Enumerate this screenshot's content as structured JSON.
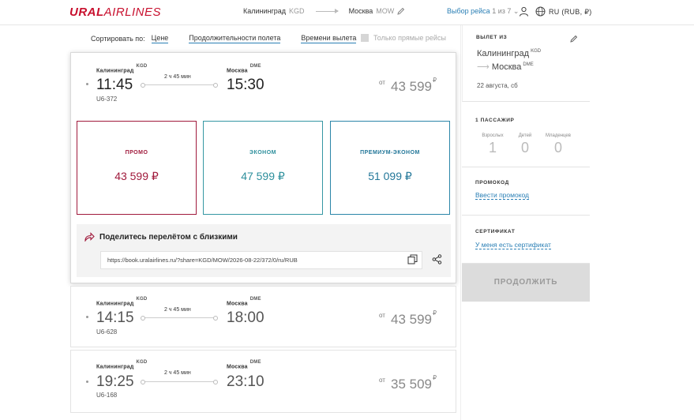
{
  "header": {
    "logo_bold": "URAL",
    "logo_rest": "AIRLINES",
    "from_city": "Калининград",
    "from_code": "KGD",
    "to_city": "Москва",
    "to_code": "MOW",
    "flight_select_label": "Выбор рейса",
    "flight_select_count": "1 из 7",
    "language": "RU (RUB, ₽)"
  },
  "sortbar": {
    "label": "Сортировать по:",
    "options": [
      "Цене",
      "Продолжительности полета",
      "Времени вылета"
    ],
    "direct_only": "Только прямые рейсы"
  },
  "flights": [
    {
      "from_city": "Калининград",
      "from_code": "KGD",
      "to_city": "Москва",
      "to_code": "DME",
      "dep": "11:45",
      "arr": "15:30",
      "duration": "2 ч 45 мин",
      "flight_no": "U6-372",
      "from_label": "от",
      "price": "43 599",
      "currency": "₽"
    },
    {
      "from_city": "Калининград",
      "from_code": "KGD",
      "to_city": "Москва",
      "to_code": "DME",
      "dep": "14:15",
      "arr": "18:00",
      "duration": "2 ч 45 мин",
      "flight_no": "U6-628",
      "from_label": "от",
      "price": "43 599",
      "currency": "₽"
    },
    {
      "from_city": "Калининград",
      "from_code": "KGD",
      "to_city": "Москва",
      "to_code": "DME",
      "dep": "19:25",
      "arr": "23:10",
      "duration": "2 ч 45 мин",
      "flight_no": "U6-168",
      "from_label": "от",
      "price": "35 509",
      "currency": "₽"
    }
  ],
  "fares": [
    {
      "name": "ПРОМО",
      "price": "43 599 ₽",
      "color": "#a01a3c"
    },
    {
      "name": "ЭКОНОМ",
      "price": "47 599 ₽",
      "color": "#2d8f9c"
    },
    {
      "name": "ПРЕМИУМ-ЭКОНОМ",
      "price": "51 099 ₽",
      "color": "#237799"
    }
  ],
  "share": {
    "title": "Поделитесь перелётом с близкими",
    "url": "https://book.uralairlines.ru/?share=KGD/MOW/2026-08-22/372/0/ru/RUB"
  },
  "sidebar": {
    "departure_label": "ВЫЛЕТ ИЗ",
    "from_city": "Калининград",
    "from_code": "KGD",
    "to_city": "Москва",
    "to_code": "DME",
    "date": "22 августа, сб",
    "passengers_label": "1 ПАССАЖИР",
    "adults_label": "Взрослых",
    "adults": "1",
    "children_label": "Детей",
    "children": "0",
    "infants_label": "Младенцев",
    "infants": "0",
    "promo_label": "ПРОМОКОД",
    "promo_link": "Ввести промокод",
    "cert_label": "СЕРТИФИКАТ",
    "cert_link": "У меня есть сертификат",
    "continue": "ПРОДОЛЖИТЬ"
  },
  "colors": {
    "brand": "#c8102e",
    "link": "#2a7fb5",
    "promo": "#a01a3c",
    "econ": "#2d8f9c",
    "premium": "#237799"
  }
}
